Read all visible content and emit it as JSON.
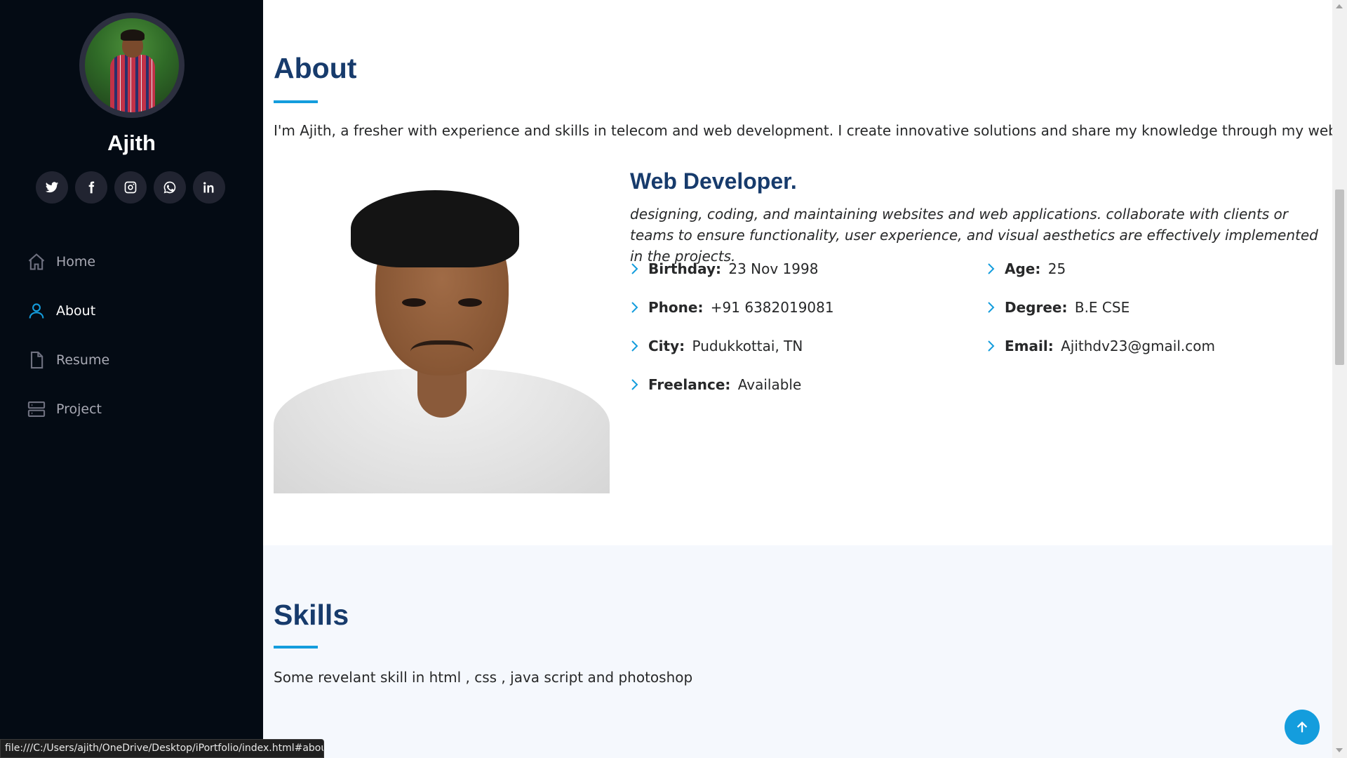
{
  "sidebar": {
    "name": "Ajith",
    "social": [
      {
        "icon": "twitter-icon"
      },
      {
        "icon": "facebook-icon"
      },
      {
        "icon": "instagram-icon"
      },
      {
        "icon": "whatsapp-icon"
      },
      {
        "icon": "linkedin-icon"
      }
    ],
    "nav": [
      {
        "label": "Home",
        "icon": "home-icon",
        "active": false
      },
      {
        "label": "About",
        "icon": "person-icon",
        "active": true
      },
      {
        "label": "Resume",
        "icon": "file-icon",
        "active": false
      },
      {
        "label": "Project",
        "icon": "server-icon",
        "active": false
      }
    ]
  },
  "status_url": "file:///C:/Users/ajith/OneDrive/Desktop/iPortfolio/index.html#about",
  "about": {
    "title": "About",
    "intro": "I'm Ajith, a fresher with experience and skills in telecom and web development. I create innovative solutions and share my knowledge through my website..",
    "role": "Web Developer.",
    "role_desc": "designing, coding, and maintaining websites and web applications. collaborate with clients or teams to ensure functionality, user experience, and visual aesthetics are effectively implemented in the projects.",
    "info": [
      {
        "label": "Birthday:",
        "value": "23 Nov 1998"
      },
      {
        "label": "Phone:",
        "value": "+91 6382019081"
      },
      {
        "label": "City:",
        "value": "Pudukkottai, TN"
      },
      {
        "label": "Freelance:",
        "value": "Available"
      },
      {
        "label": "Age:",
        "value": "25"
      },
      {
        "label": "Degree:",
        "value": "B.E CSE"
      },
      {
        "label": "Email:",
        "value": "Ajithdv23@gmail.com"
      }
    ]
  },
  "skills": {
    "title": "Skills",
    "desc": "Some revelant skill in html , css , java script and photoshop"
  },
  "colors": {
    "accent": "#149ddd",
    "heading": "#173b6c",
    "sidebar_bg": "#040b14"
  }
}
